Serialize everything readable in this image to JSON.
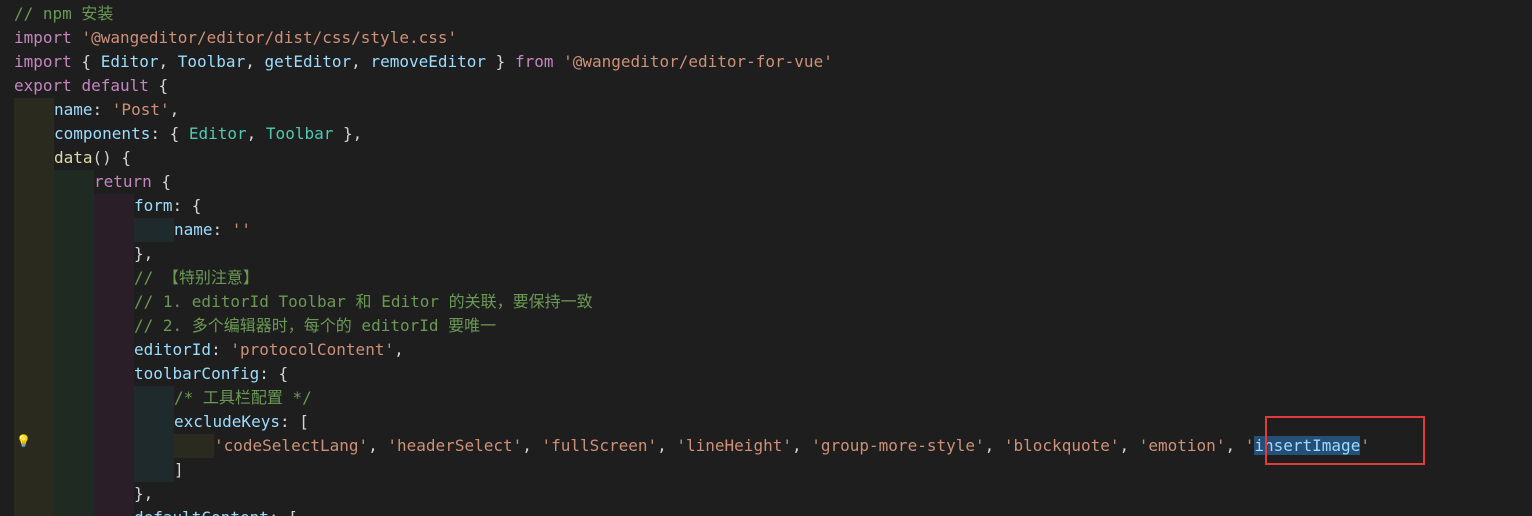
{
  "lines": [
    {
      "tokens": [
        {
          "t": "// npm 安装",
          "c": "com"
        }
      ]
    },
    {
      "tokens": [
        {
          "t": "import",
          "c": "kw"
        },
        {
          "t": " ",
          "c": "pun"
        },
        {
          "t": "'@wangeditor/editor/dist/css/style.css'",
          "c": "str"
        }
      ]
    },
    {
      "tokens": [
        {
          "t": "import",
          "c": "kw"
        },
        {
          "t": " { ",
          "c": "pun"
        },
        {
          "t": "Editor",
          "c": "prop"
        },
        {
          "t": ", ",
          "c": "pun"
        },
        {
          "t": "Toolbar",
          "c": "prop"
        },
        {
          "t": ", ",
          "c": "pun"
        },
        {
          "t": "getEditor",
          "c": "prop"
        },
        {
          "t": ", ",
          "c": "pun"
        },
        {
          "t": "removeEditor",
          "c": "prop"
        },
        {
          "t": " } ",
          "c": "pun"
        },
        {
          "t": "from",
          "c": "kw"
        },
        {
          "t": " ",
          "c": "pun"
        },
        {
          "t": "'@wangeditor/editor-for-vue'",
          "c": "str"
        }
      ]
    },
    {
      "tokens": [
        {
          "t": "export",
          "c": "kw"
        },
        {
          "t": " ",
          "c": "pun"
        },
        {
          "t": "default",
          "c": "kw"
        },
        {
          "t": " {",
          "c": "pun"
        }
      ]
    },
    {
      "tokens": [
        {
          "t": "name",
          "c": "prop"
        },
        {
          "t": ": ",
          "c": "pun"
        },
        {
          "t": "'Post'",
          "c": "str"
        },
        {
          "t": ",",
          "c": "pun"
        }
      ]
    },
    {
      "tokens": [
        {
          "t": "components",
          "c": "prop"
        },
        {
          "t": ": { ",
          "c": "pun"
        },
        {
          "t": "Editor",
          "c": "cls"
        },
        {
          "t": ", ",
          "c": "pun"
        },
        {
          "t": "Toolbar",
          "c": "cls"
        },
        {
          "t": " },",
          "c": "pun"
        }
      ]
    },
    {
      "tokens": [
        {
          "t": "data",
          "c": "fn"
        },
        {
          "t": "() {",
          "c": "pun"
        }
      ]
    },
    {
      "tokens": [
        {
          "t": "return",
          "c": "kw"
        },
        {
          "t": " {",
          "c": "pun"
        }
      ]
    },
    {
      "tokens": [
        {
          "t": "form",
          "c": "prop"
        },
        {
          "t": ": {",
          "c": "pun"
        }
      ]
    },
    {
      "tokens": [
        {
          "t": "name",
          "c": "prop"
        },
        {
          "t": ": ",
          "c": "pun"
        },
        {
          "t": "''",
          "c": "str"
        }
      ]
    },
    {
      "tokens": [
        {
          "t": "},",
          "c": "pun"
        }
      ]
    },
    {
      "tokens": [
        {
          "t": "// 【特别注意】",
          "c": "com"
        }
      ]
    },
    {
      "tokens": [
        {
          "t": "// 1. editorId Toolbar 和 Editor 的关联，要保持一致",
          "c": "com"
        }
      ]
    },
    {
      "tokens": [
        {
          "t": "// 2. 多个编辑器时，每个的 editorId 要唯一",
          "c": "com"
        }
      ]
    },
    {
      "tokens": [
        {
          "t": "editorId",
          "c": "prop"
        },
        {
          "t": ": ",
          "c": "pun"
        },
        {
          "t": "'protocolContent'",
          "c": "str"
        },
        {
          "t": ",",
          "c": "pun"
        }
      ]
    },
    {
      "tokens": [
        {
          "t": "toolbarConfig",
          "c": "prop"
        },
        {
          "t": ": {",
          "c": "pun"
        }
      ]
    },
    {
      "tokens": [
        {
          "t": "/* 工具栏配置 */",
          "c": "com"
        }
      ]
    },
    {
      "tokens": [
        {
          "t": "excludeKeys",
          "c": "prop"
        },
        {
          "t": ": [",
          "c": "pun"
        }
      ]
    },
    {
      "tokens": [
        {
          "t": "'codeSelectLang'",
          "c": "str"
        },
        {
          "t": ", ",
          "c": "pun"
        },
        {
          "t": "'headerSelect'",
          "c": "str"
        },
        {
          "t": ", ",
          "c": "pun"
        },
        {
          "t": "'fullScreen'",
          "c": "str"
        },
        {
          "t": ", ",
          "c": "pun"
        },
        {
          "t": "'lineHeight'",
          "c": "str"
        },
        {
          "t": ", ",
          "c": "pun"
        },
        {
          "t": "'group-more-style'",
          "c": "str"
        },
        {
          "t": ", ",
          "c": "pun"
        },
        {
          "t": "'blockquote'",
          "c": "str"
        },
        {
          "t": ", ",
          "c": "pun"
        },
        {
          "t": "'emotion'",
          "c": "str"
        },
        {
          "t": ", ",
          "c": "pun"
        },
        {
          "t": "'",
          "c": "str"
        },
        {
          "t": "insertImage",
          "c": "sel"
        },
        {
          "t": "'",
          "c": "str"
        }
      ]
    },
    {
      "tokens": [
        {
          "t": "]",
          "c": "pun"
        }
      ]
    },
    {
      "tokens": [
        {
          "t": "},",
          "c": "pun"
        }
      ]
    },
    {
      "tokens": [
        {
          "t": "defaultContent",
          "c": "prop"
        },
        {
          "t": ": [",
          "c": "pun"
        }
      ]
    }
  ],
  "indent": [
    0,
    0,
    0,
    0,
    1,
    1,
    1,
    2,
    3,
    4,
    3,
    3,
    3,
    3,
    3,
    3,
    4,
    4,
    5,
    4,
    3,
    3
  ],
  "icons": {
    "lightbulb": "lightbulb-icon"
  }
}
